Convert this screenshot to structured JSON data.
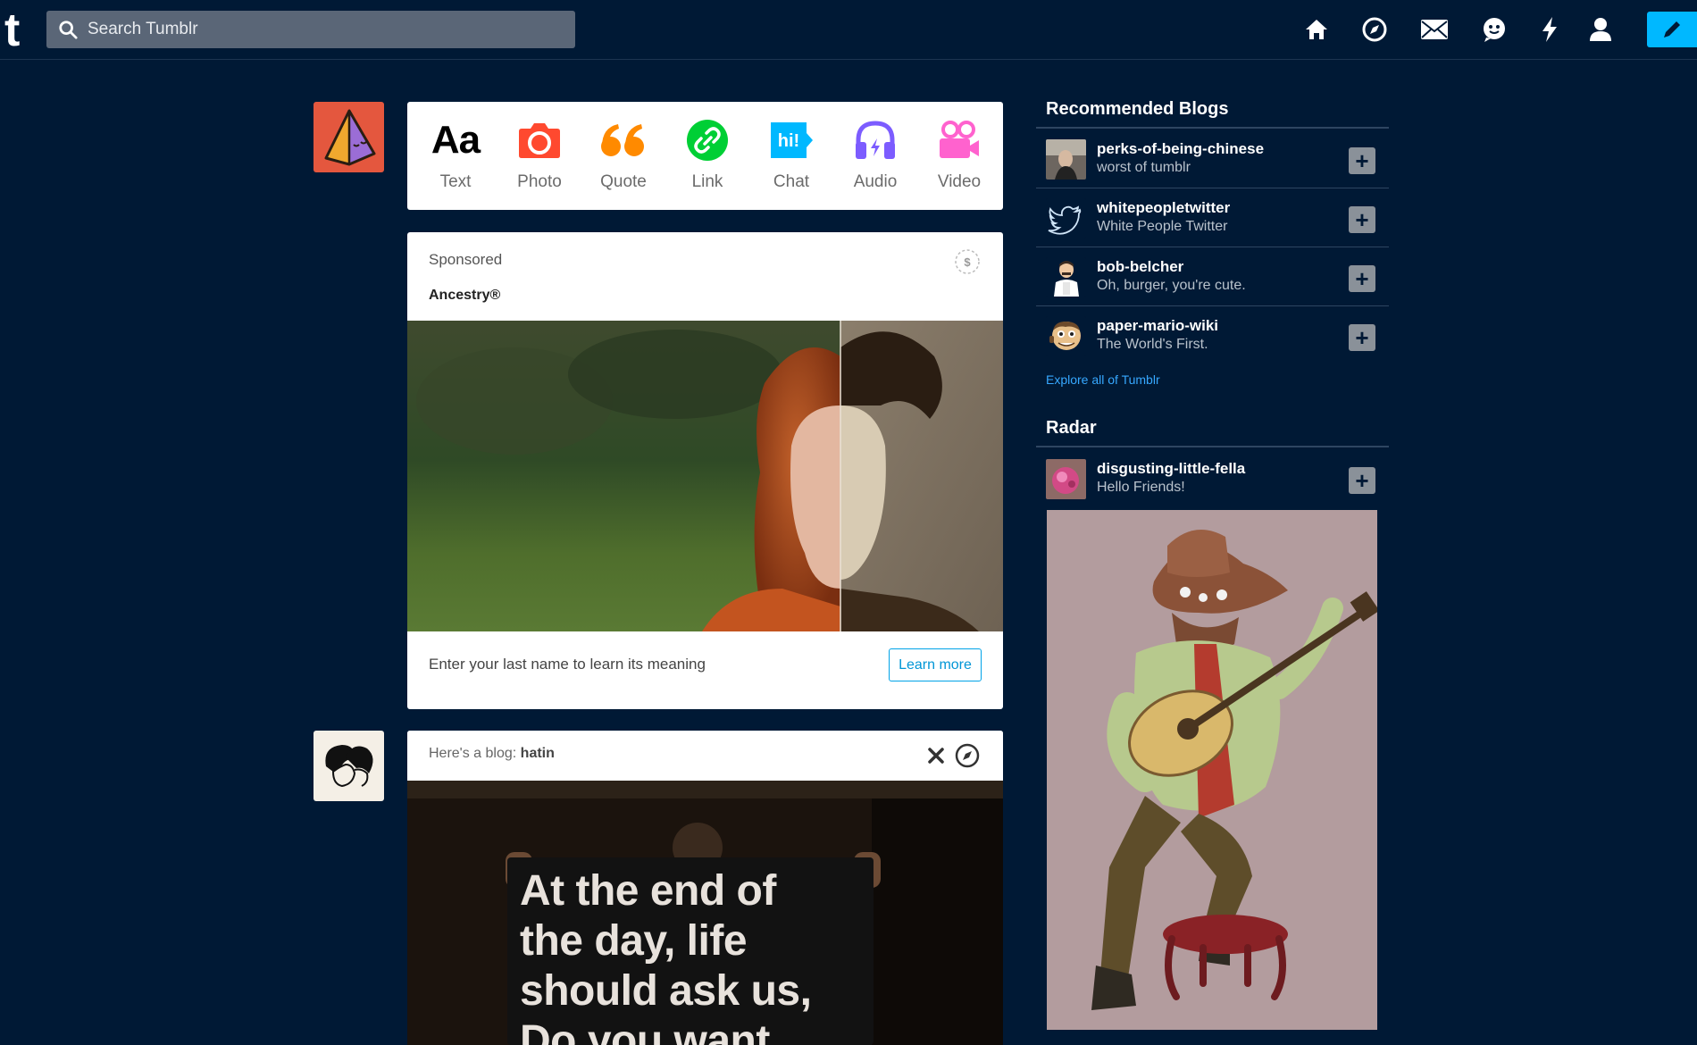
{
  "header": {
    "logo": "t",
    "search_placeholder": "Search Tumblr",
    "nav": [
      "home-icon",
      "explore-icon",
      "inbox-icon",
      "messages-icon",
      "activity-icon",
      "account-icon"
    ],
    "compose_icon": "pencil-icon",
    "accent": "#00b8ff"
  },
  "post_types": [
    {
      "label": "Text",
      "icon": "text-icon",
      "color": "#000000",
      "glyph": "Aa"
    },
    {
      "label": "Photo",
      "icon": "camera-icon",
      "color": "#ff492f"
    },
    {
      "label": "Quote",
      "icon": "quote-icon",
      "color": "#ff8a00"
    },
    {
      "label": "Link",
      "icon": "link-icon",
      "color": "#00cf35"
    },
    {
      "label": "Chat",
      "icon": "chat-icon",
      "color": "#00b8ff",
      "glyph": "hi!"
    },
    {
      "label": "Audio",
      "icon": "headphones-icon",
      "color": "#7c5cff"
    },
    {
      "label": "Video",
      "icon": "video-camera-icon",
      "color": "#ff62ce"
    }
  ],
  "sponsored": {
    "label": "Sponsored",
    "advertiser": "Ancestry®",
    "caption": "Enter your last name to learn its meaning",
    "cta": "Learn more"
  },
  "suggestion": {
    "prefix": "Here's a blog:",
    "blog": "hatin",
    "image_text": [
      "At the end of",
      "the day, life",
      "should ask us,",
      "Do you want"
    ]
  },
  "sidebar": {
    "recommended_title": "Recommended Blogs",
    "recommended": [
      {
        "name": "perks-of-being-chinese",
        "desc": "worst of tumblr"
      },
      {
        "name": "whitepeopletwitter",
        "desc": "White People Twitter"
      },
      {
        "name": "bob-belcher",
        "desc": "Oh, burger, you're cute."
      },
      {
        "name": "paper-mario-wiki",
        "desc": "The World's First."
      }
    ],
    "explore_link": "Explore all of Tumblr",
    "radar_title": "Radar",
    "radar": {
      "name": "disgusting-little-fella",
      "desc": "Hello Friends!"
    },
    "follow_glyph": "+"
  }
}
